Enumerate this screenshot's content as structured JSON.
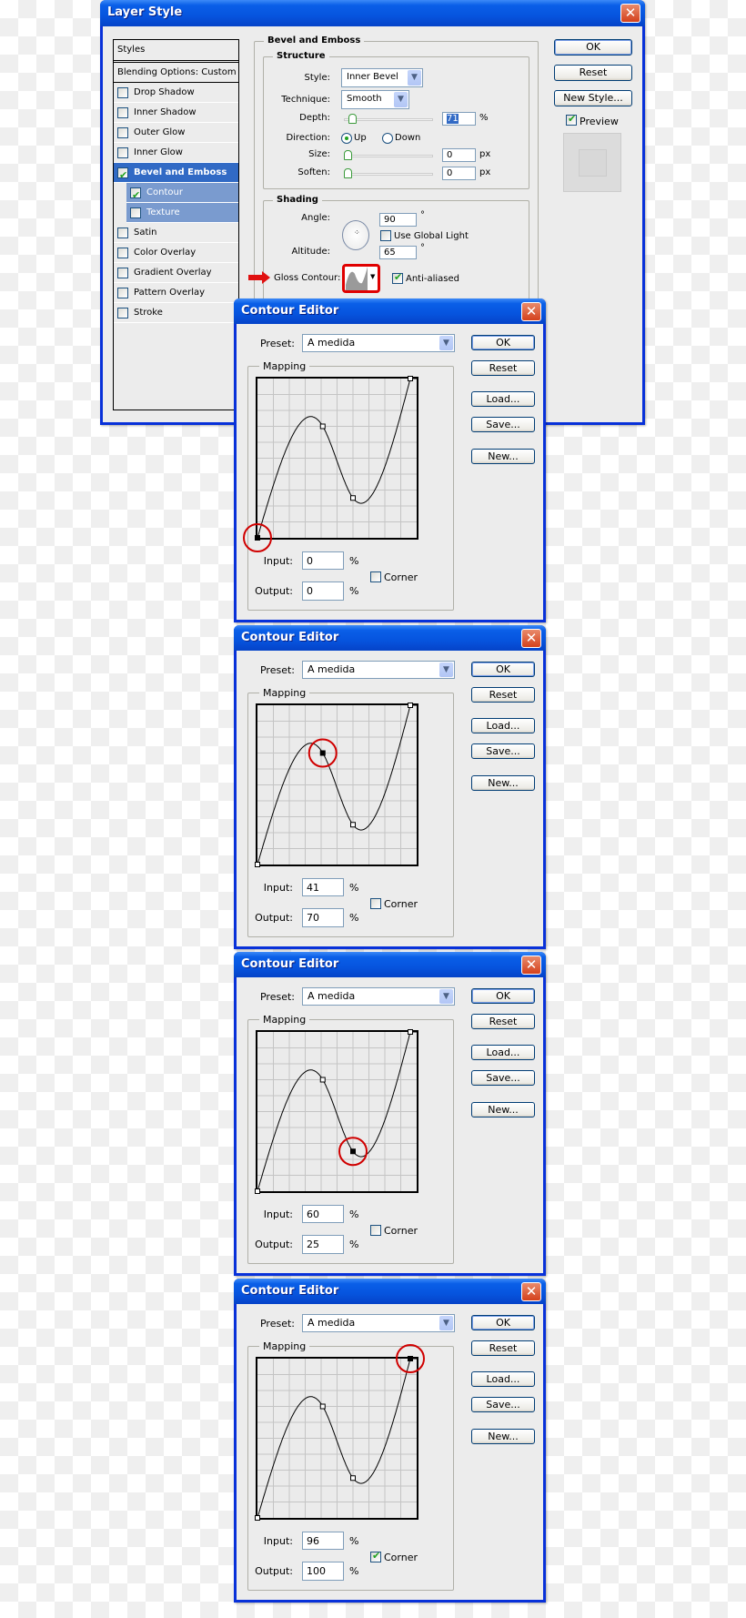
{
  "layer_style": {
    "title": "Layer Style",
    "styles_header": "Styles",
    "blending_options": "Blending Options: Custom",
    "items": [
      {
        "label": "Drop Shadow",
        "checked": false
      },
      {
        "label": "Inner Shadow",
        "checked": false
      },
      {
        "label": "Outer Glow",
        "checked": false
      },
      {
        "label": "Inner Glow",
        "checked": false
      },
      {
        "label": "Bevel and Emboss",
        "checked": true,
        "active": true
      },
      {
        "label": "Contour",
        "checked": true,
        "sub": true
      },
      {
        "label": "Texture",
        "checked": false,
        "sub": true
      },
      {
        "label": "Satin",
        "checked": false
      },
      {
        "label": "Color Overlay",
        "checked": false
      },
      {
        "label": "Gradient Overlay",
        "checked": false
      },
      {
        "label": "Pattern Overlay",
        "checked": false
      },
      {
        "label": "Stroke",
        "checked": false
      }
    ],
    "section_title": "Bevel and Emboss",
    "structure": {
      "legend": "Structure",
      "style_label": "Style:",
      "style_value": "Inner Bevel",
      "technique_label": "Technique:",
      "technique_value": "Smooth",
      "depth_label": "Depth:",
      "depth_value": "71",
      "depth_unit": "%",
      "direction_label": "Direction:",
      "direction_up": "Up",
      "direction_down": "Down",
      "direction_selected": "Up",
      "size_label": "Size:",
      "size_value": "0",
      "size_unit": "px",
      "soften_label": "Soften:",
      "soften_value": "0",
      "soften_unit": "px"
    },
    "shading": {
      "legend": "Shading",
      "angle_label": "Angle:",
      "angle_value": "90",
      "angle_unit": "°",
      "global_light_label": "Use Global Light",
      "global_light_checked": false,
      "altitude_label": "Altitude:",
      "altitude_value": "65",
      "altitude_unit": "°",
      "gloss_contour_label": "Gloss Contour:",
      "anti_aliased_label": "Anti-aliased",
      "anti_aliased_checked": true
    },
    "buttons": {
      "ok": "OK",
      "reset": "Reset",
      "new_style": "New Style..."
    },
    "preview_label": "Preview",
    "preview_checked": true
  },
  "contour_editors": [
    {
      "title": "Contour Editor",
      "preset_label": "Preset:",
      "preset_value": "A medida",
      "mapping_label": "Mapping",
      "ok": "OK",
      "reset": "Reset",
      "load": "Load...",
      "save": "Save...",
      "new": "New...",
      "input_label": "Input:",
      "input_value": "0",
      "output_label": "Output:",
      "output_value": "0",
      "unit": "%",
      "corner_label": "Corner",
      "corner_checked": false,
      "selected_point": 0
    },
    {
      "title": "Contour Editor",
      "preset_label": "Preset:",
      "preset_value": "A medida",
      "mapping_label": "Mapping",
      "ok": "OK",
      "reset": "Reset",
      "load": "Load...",
      "save": "Save...",
      "new": "New...",
      "input_label": "Input:",
      "input_value": "41",
      "output_label": "Output:",
      "output_value": "70",
      "unit": "%",
      "corner_label": "Corner",
      "corner_checked": false,
      "selected_point": 1
    },
    {
      "title": "Contour Editor",
      "preset_label": "Preset:",
      "preset_value": "A medida",
      "mapping_label": "Mapping",
      "ok": "OK",
      "reset": "Reset",
      "load": "Load...",
      "save": "Save...",
      "new": "New...",
      "input_label": "Input:",
      "input_value": "60",
      "output_label": "Output:",
      "output_value": "25",
      "unit": "%",
      "corner_label": "Corner",
      "corner_checked": false,
      "selected_point": 2
    },
    {
      "title": "Contour Editor",
      "preset_label": "Preset:",
      "preset_value": "A medida",
      "mapping_label": "Mapping",
      "ok": "OK",
      "reset": "Reset",
      "load": "Load...",
      "save": "Save...",
      "new": "New...",
      "input_label": "Input:",
      "input_value": "96",
      "output_label": "Output:",
      "output_value": "100",
      "unit": "%",
      "corner_label": "Corner",
      "corner_checked": true,
      "selected_point": 3
    }
  ],
  "contour_points": [
    [
      0,
      0
    ],
    [
      41,
      70
    ],
    [
      60,
      25
    ],
    [
      96,
      100
    ]
  ],
  "colors": {
    "title_bar": "#0654de",
    "window_border": "#0831d9",
    "highlight": "#d00000",
    "selected_item": "#316ac5"
  }
}
